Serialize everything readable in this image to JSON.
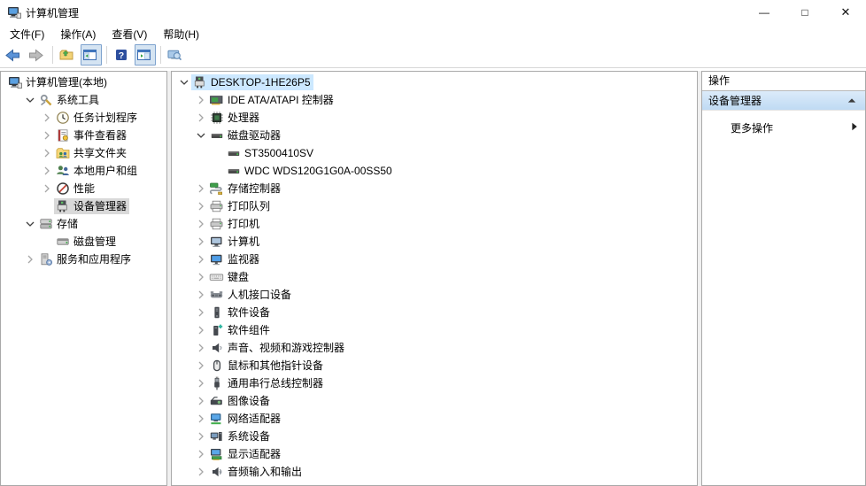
{
  "window": {
    "title": "计算机管理",
    "icon": "computer-management-icon",
    "controls": {
      "minimize": "—",
      "maximize": "□",
      "close": "✕"
    }
  },
  "menubar": {
    "items": [
      {
        "label": "文件(F)"
      },
      {
        "label": "操作(A)"
      },
      {
        "label": "查看(V)"
      },
      {
        "label": "帮助(H)"
      }
    ]
  },
  "toolbar": {
    "buttons": [
      {
        "icon": "back-arrow-icon",
        "pressed": false
      },
      {
        "icon": "forward-arrow-icon",
        "pressed": false
      },
      {
        "separator": true
      },
      {
        "icon": "folder-icon",
        "pressed": false
      },
      {
        "icon": "show-console-tree-icon",
        "pressed": true
      },
      {
        "separator": true
      },
      {
        "icon": "help-icon",
        "pressed": false
      },
      {
        "icon": "show-action-pane-icon",
        "pressed": true
      },
      {
        "separator": true
      },
      {
        "icon": "search-computer-icon",
        "pressed": false
      }
    ]
  },
  "left_panel": {
    "items": [
      {
        "label": "计算机管理(本地)",
        "icon": "computer-management-icon",
        "level": 0,
        "expander": "hidden"
      },
      {
        "label": "系统工具",
        "icon": "system-tools-icon",
        "level": 1,
        "expander": "down"
      },
      {
        "label": "任务计划程序",
        "icon": "task-scheduler-icon",
        "level": 2,
        "expander": "right"
      },
      {
        "label": "事件查看器",
        "icon": "event-viewer-icon",
        "level": 2,
        "expander": "right"
      },
      {
        "label": "共享文件夹",
        "icon": "shared-folders-icon",
        "level": 2,
        "expander": "right"
      },
      {
        "label": "本地用户和组",
        "icon": "local-users-icon",
        "level": 2,
        "expander": "right"
      },
      {
        "label": "性能",
        "icon": "performance-icon",
        "level": 2,
        "expander": "right"
      },
      {
        "label": "设备管理器",
        "icon": "device-manager-icon",
        "level": 2,
        "expander": "none",
        "selected": "inactive"
      },
      {
        "label": "存储",
        "icon": "storage-icon",
        "level": 1,
        "expander": "down"
      },
      {
        "label": "磁盘管理",
        "icon": "disk-management-icon",
        "level": 2,
        "expander": "none"
      },
      {
        "label": "服务和应用程序",
        "icon": "services-icon",
        "level": 1,
        "expander": "right"
      }
    ]
  },
  "center_panel": {
    "items": [
      {
        "label": "DESKTOP-1HE26P5",
        "icon": "device-manager-icon",
        "level": 0,
        "expander": "down",
        "selected": "active"
      },
      {
        "label": "IDE ATA/ATAPI 控制器",
        "icon": "ide-controller-icon",
        "level": 1,
        "expander": "right"
      },
      {
        "label": "处理器",
        "icon": "processor-icon",
        "level": 1,
        "expander": "right"
      },
      {
        "label": "磁盘驱动器",
        "icon": "disk-drive-icon",
        "level": 1,
        "expander": "down"
      },
      {
        "label": "ST3500410SV",
        "icon": "disk-drive-icon",
        "level": 2,
        "expander": "none"
      },
      {
        "label": "WDC WDS120G1G0A-00SS50",
        "icon": "disk-drive-icon",
        "level": 2,
        "expander": "none"
      },
      {
        "label": "存储控制器",
        "icon": "storage-controller-icon",
        "level": 1,
        "expander": "right"
      },
      {
        "label": "打印队列",
        "icon": "print-queue-icon",
        "level": 1,
        "expander": "right"
      },
      {
        "label": "打印机",
        "icon": "printer-icon",
        "level": 1,
        "expander": "right"
      },
      {
        "label": "计算机",
        "icon": "computer-icon",
        "level": 1,
        "expander": "right"
      },
      {
        "label": "监视器",
        "icon": "monitor-icon",
        "level": 1,
        "expander": "right"
      },
      {
        "label": "键盘",
        "icon": "keyboard-icon",
        "level": 1,
        "expander": "right"
      },
      {
        "label": "人机接口设备",
        "icon": "hid-icon",
        "level": 1,
        "expander": "right"
      },
      {
        "label": "软件设备",
        "icon": "software-device-icon",
        "level": 1,
        "expander": "right"
      },
      {
        "label": "软件组件",
        "icon": "software-component-icon",
        "level": 1,
        "expander": "right"
      },
      {
        "label": "声音、视频和游戏控制器",
        "icon": "sound-icon",
        "level": 1,
        "expander": "right"
      },
      {
        "label": "鼠标和其他指针设备",
        "icon": "mouse-icon",
        "level": 1,
        "expander": "right"
      },
      {
        "label": "通用串行总线控制器",
        "icon": "usb-icon",
        "level": 1,
        "expander": "right"
      },
      {
        "label": "图像设备",
        "icon": "imaging-icon",
        "level": 1,
        "expander": "right"
      },
      {
        "label": "网络适配器",
        "icon": "network-adapter-icon",
        "level": 1,
        "expander": "right"
      },
      {
        "label": "系统设备",
        "icon": "system-device-icon",
        "level": 1,
        "expander": "right"
      },
      {
        "label": "显示适配器",
        "icon": "display-adapter-icon",
        "level": 1,
        "expander": "right"
      },
      {
        "label": "音频输入和输出",
        "icon": "audio-io-icon",
        "level": 1,
        "expander": "right"
      }
    ]
  },
  "right_panel": {
    "title": "操作",
    "section": {
      "label": "设备管理器",
      "collapse_icon": "collapse-triangle-icon"
    },
    "more_actions": {
      "label": "更多操作",
      "arrow_icon": "more-actions-arrow-icon"
    }
  },
  "colors": {
    "selection_active": "#cce8ff",
    "selection_inactive": "#d9d9d9",
    "section_bar_top": "#dcebfa",
    "section_bar_bottom": "#bfdaf3",
    "toolbar_pressed_bg": "#d5e4f2",
    "toolbar_pressed_border": "#7da2ce",
    "panel_border": "#a9a9a9"
  }
}
